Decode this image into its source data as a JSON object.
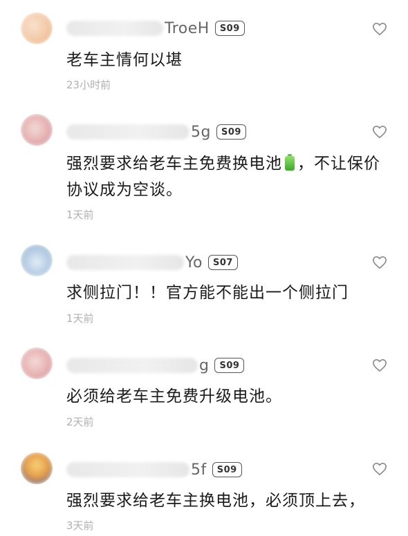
{
  "comments": [
    {
      "name_suffix": "TroeH",
      "badge": "S09",
      "text": "老车主情何以堪",
      "time": "23小时前",
      "avatar_colors": [
        "#f3c9a6",
        "#e6a87d",
        "#f8e2cf"
      ]
    },
    {
      "name_suffix": "5g",
      "badge": "S09",
      "text_before": "强烈要求给老车主免费换电池",
      "text_after": "，不让保价协议成为空谈。",
      "icon": "battery-emoji",
      "time": "1天前",
      "avatar_colors": [
        "#e7b3b3",
        "#c9868d",
        "#f2dcd8"
      ]
    },
    {
      "name_suffix": "Yo",
      "badge": "S07",
      "text": "求侧拉门！！官方能不能出一个侧拉门",
      "time": "1天前",
      "avatar_colors": [
        "#b6cde3",
        "#8fb0d1",
        "#e4eef7"
      ]
    },
    {
      "name_suffix": "g",
      "badge": "S09",
      "text": "必须给老车主免费升级电池。",
      "time": "2天前",
      "avatar_colors": [
        "#e8b4b4",
        "#c98b8f",
        "#f3dcd9"
      ]
    },
    {
      "name_suffix": "5f",
      "badge": "S09",
      "text": "强烈要求给老车主换电池，必须顶上去，",
      "time": "3天前",
      "avatar_colors": [
        "#4a5fa8",
        "#e8a04a",
        "#f5d27a"
      ]
    }
  ]
}
